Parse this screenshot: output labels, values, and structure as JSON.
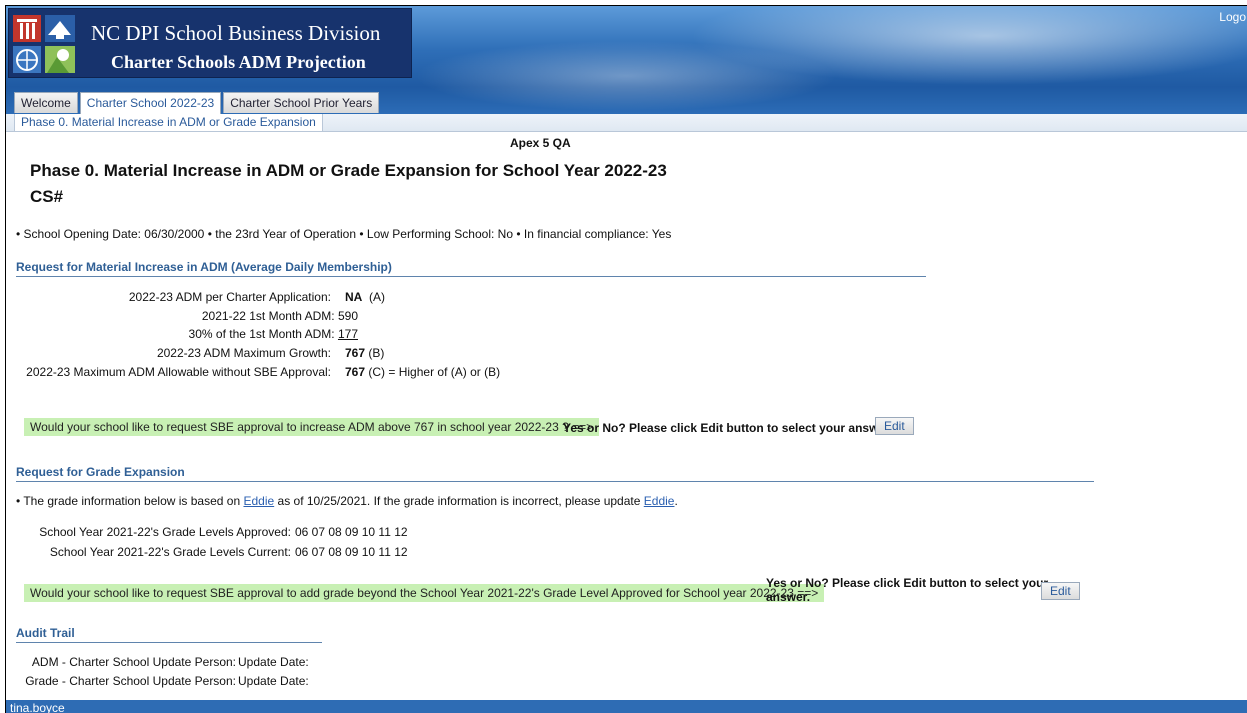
{
  "header": {
    "title": "NC DPI School Business Division",
    "subtitle": "Charter Schools ADM Projection",
    "logout": "Logo"
  },
  "tabs": [
    {
      "label": "Welcome",
      "active": false
    },
    {
      "label": "Charter School 2022-23",
      "active": true
    },
    {
      "label": "Charter School Prior Years",
      "active": false
    }
  ],
  "subtab": "Phase 0. Material Increase in ADM or Grade Expansion",
  "environment": "Apex 5 QA",
  "page_title": "Phase 0. Material Increase in ADM or Grade Expansion for School Year 2022-23",
  "cs_label": "CS#",
  "info": {
    "opening": "School Opening Date: 06/30/2000",
    "year": "the 23rd Year of Operation",
    "low_performing": "Low Performing School: No",
    "financial": "In financial compliance: Yes"
  },
  "adm_section": {
    "header": "Request for Material Increase in ADM (Average Daily Membership)",
    "rows": [
      {
        "label": "2022-23 ADM per Charter Application:",
        "value": "NA",
        "suffix": "(A)"
      },
      {
        "label": "2021-22 1st Month ADM:",
        "value": "590"
      },
      {
        "label": "30% of the 1st Month ADM:",
        "value": "177"
      },
      {
        "label": "2022-23 ADM Maximum Growth:",
        "value": "767",
        "suffix": "(B)"
      },
      {
        "label": "2022-23 Maximum ADM Allowable without SBE Approval:",
        "value": "767",
        "suffix": "(C) = Higher of (A) or (B)"
      }
    ],
    "question": "Would your school like to request SBE approval to increase ADM above 767 in school year 2022-23 ? ==>",
    "answer": "Yes or No? Please click Edit button to select your answer.",
    "edit": "Edit"
  },
  "grade_section": {
    "header": "Request for Grade Expansion",
    "note_before": "The grade information below is based on",
    "note_link1": "Eddie",
    "note_middle": "as of 10/25/2021. If the grade information is incorrect, please update",
    "note_link2": "Eddie",
    "note_end": ".",
    "approved_label": "School Year 2021-22's Grade Levels Approved:",
    "approved_value": "06 07 08 09 10 11 12",
    "current_label": "School Year 2021-22's Grade Levels Current:",
    "current_value": "06 07 08 09 10 11 12",
    "question": "Would your school like to request SBE approval to add grade beyond the School Year 2021-22's Grade Level Approved for School year 2022-23 ==>",
    "answer_line1": "Yes or No? Please click Edit button to select your",
    "answer_line2": "answer.",
    "edit": "Edit"
  },
  "audit": {
    "header": "Audit Trail",
    "adm_person_label": "ADM - Charter School Update Person:",
    "adm_date_label": "Update Date:",
    "grade_person_label": "Grade - Charter School Update Person:",
    "grade_date_label": "Update Date:"
  },
  "footer_user": "tina.boyce"
}
